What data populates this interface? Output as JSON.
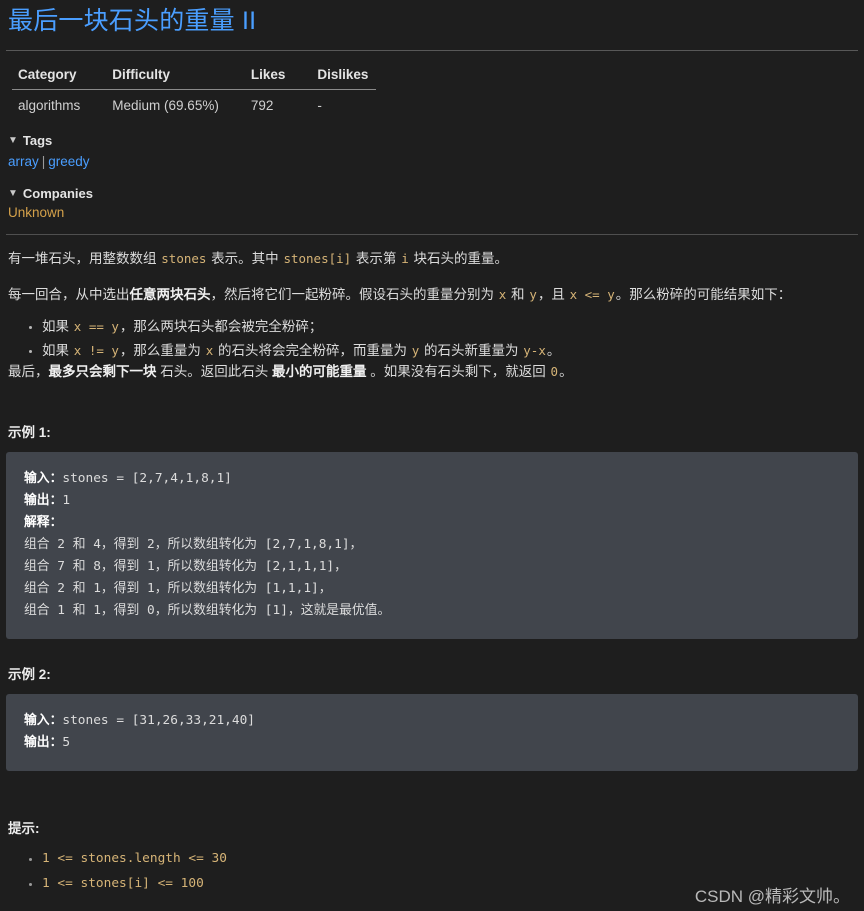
{
  "problem": {
    "title": "最后一块石头的重量 II"
  },
  "meta_table": {
    "headers": [
      "Category",
      "Difficulty",
      "Likes",
      "Dislikes"
    ],
    "row": {
      "category": "algorithms",
      "difficulty": "Medium (69.65%)",
      "likes": "792",
      "dislikes": "-"
    }
  },
  "tags_section": {
    "caret": "▼",
    "heading": "Tags",
    "items": [
      "array",
      "greedy"
    ],
    "separator": "|"
  },
  "companies_section": {
    "caret": "▼",
    "heading": "Companies",
    "value": "Unknown"
  },
  "description": {
    "p1": {
      "t1": "有一堆石头，用整数数组 ",
      "c1": "stones",
      "t2": " 表示。其中 ",
      "c2": "stones[i]",
      "t3": " 表示第 ",
      "c3": "i",
      "t4": " 块石头的重量。"
    },
    "p2": {
      "t1": "每一回合，从中选出",
      "b1": "任意两块石头",
      "t2": "，然后将它们一起粉碎。假设石头的重量分别为 ",
      "c1": "x",
      "t3": " 和 ",
      "c2": "y",
      "t4": "，且 ",
      "c3": "x <= y",
      "t5": "。那么粉碎的可能结果如下："
    },
    "bullets": [
      {
        "t1": "如果 ",
        "c1": "x == y",
        "t2": "，那么两块石头都会被完全粉碎；"
      },
      {
        "t1": "如果 ",
        "c1": "x != y",
        "t2": "，那么重量为 ",
        "c2": "x",
        "t3": " 的石头将会完全粉碎，而重量为 ",
        "c3": "y",
        "t4": " 的石头新重量为 ",
        "c4": "y-x",
        "t5": "。"
      }
    ],
    "p3": {
      "t1": "最后，",
      "b1": "最多只会剩下一块",
      "t2": " 石头。返回此石头 ",
      "b2": "最小的可能重量",
      "t3": " 。如果没有石头剩下，就返回 ",
      "c1": "0",
      "t4": "。"
    }
  },
  "examples": [
    {
      "label": "示例 1:",
      "input_label": "输入：",
      "input_value": "stones = [2,7,4,1,8,1]",
      "output_label": "输出：",
      "output_value": "1",
      "explain_label": "解释：",
      "explain_lines": [
        "组合 2 和 4，得到 2，所以数组转化为 [2,7,1,8,1]，",
        "组合 7 和 8，得到 1，所以数组转化为 [2,1,1,1]，",
        "组合 2 和 1，得到 1，所以数组转化为 [1,1,1]，",
        "组合 1 和 1，得到 0，所以数组转化为 [1]，这就是最优值。"
      ]
    },
    {
      "label": "示例 2:",
      "input_label": "输入：",
      "input_value": "stones = [31,26,33,21,40]",
      "output_label": "输出：",
      "output_value": "5",
      "explain_label": "",
      "explain_lines": []
    }
  ],
  "hints": {
    "label": "提示:",
    "items": [
      "1 <= stones.length <= 30",
      "1 <= stones[i] <= 100"
    ]
  },
  "watermark": {
    "text": "CSDN @精彩文帅。"
  }
}
